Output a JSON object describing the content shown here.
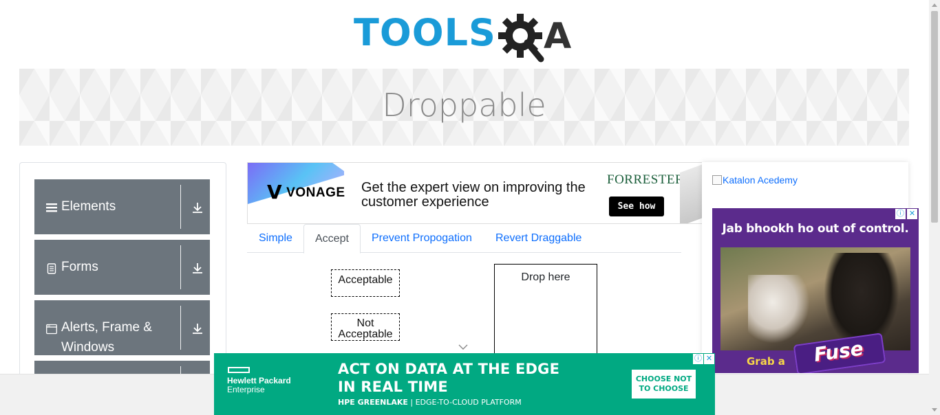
{
  "header": {
    "logo_text_tools": "TOOLS",
    "logo_text_qa": "A"
  },
  "banner": {
    "title": "Droppable"
  },
  "sidebar": {
    "groups": [
      {
        "label": "Elements",
        "icon": "hamburger-icon"
      },
      {
        "label": "Forms",
        "icon": "document-icon"
      },
      {
        "label": "Alerts, Frame &",
        "label_line2": "Windows",
        "icon": "window-icon"
      }
    ]
  },
  "top_ad": {
    "brand": "VONAGE",
    "headline": "Get the expert view on improving the customer experience",
    "partner": "FORRESTER",
    "button": "See how"
  },
  "tabs": [
    {
      "label": "Simple",
      "active": false
    },
    {
      "label": "Accept",
      "active": true
    },
    {
      "label": "Prevent Propogation",
      "active": false
    },
    {
      "label": "Revert Draggable",
      "active": false
    }
  ],
  "accept_demo": {
    "acceptable": "Acceptable",
    "not_acceptable_line1": "Not",
    "not_acceptable_line2": "Acceptable",
    "drop_target": "Drop here"
  },
  "right_ad": {
    "katalon_alt": "Katalon Acedemy",
    "fuse_title": "Jab bhookh ho out of control.",
    "fuse_grab": "Grab a",
    "fuse_brand": "Fuse"
  },
  "bottom_ad": {
    "brand_line1": "Hewlett Packard",
    "brand_line2": "Enterprise",
    "headline_line1": "ACT ON DATA AT THE EDGE",
    "headline_line2": "IN REAL TIME",
    "sub_bold": "HPE GREENLAKE",
    "sub_rest": " | EDGE-TO-CLOUD PLATFORM",
    "cta_line1": "CHOOSE NOT",
    "cta_line2": "TO CHOOSE"
  },
  "colors": {
    "tools_blue": "#1a9bd8",
    "sidebar_gray": "#6c757d",
    "link_blue": "#0d6efd",
    "hpe_green": "#01a982"
  }
}
